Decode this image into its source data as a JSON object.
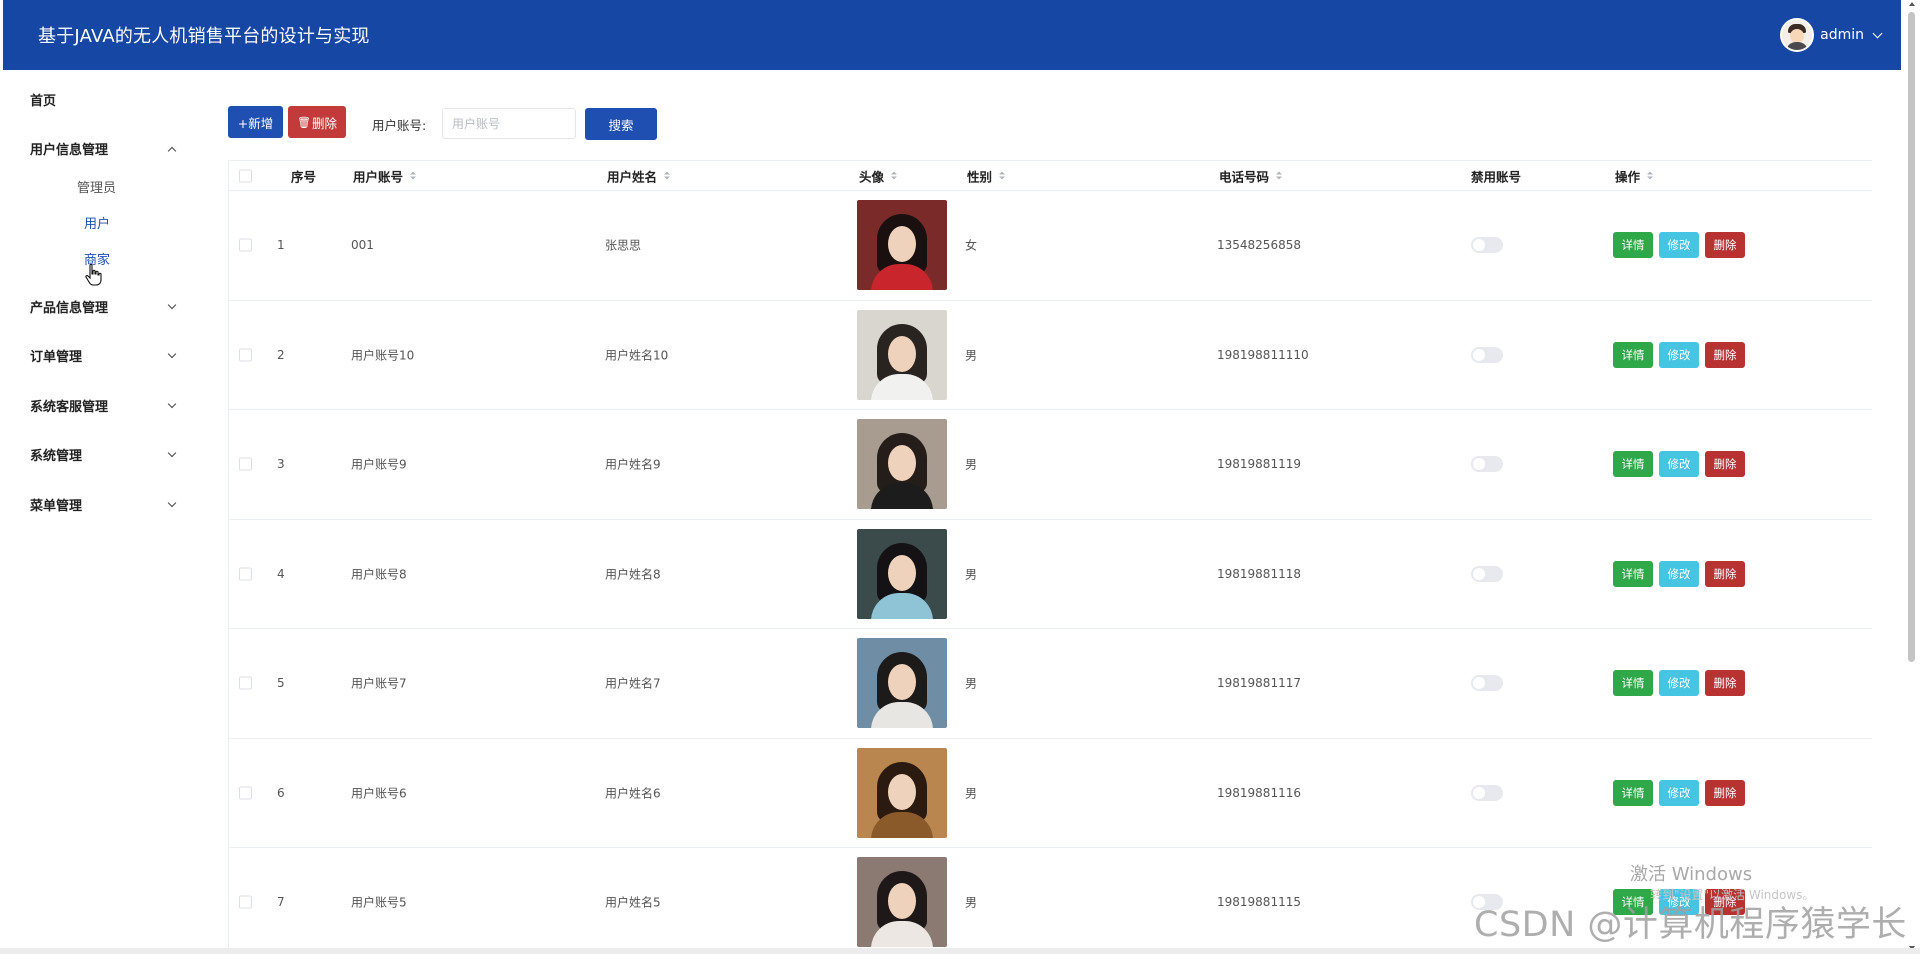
{
  "header": {
    "title": "基于JAVA的无人机销售平台的设计与实现",
    "username": "admin"
  },
  "sidebar": {
    "items": [
      {
        "label": "首页"
      },
      {
        "label": "用户信息管理",
        "expanded": true,
        "children": [
          {
            "label": "管理员"
          },
          {
            "label": "用户"
          },
          {
            "label": "商家"
          }
        ]
      },
      {
        "label": "产品信息管理"
      },
      {
        "label": "订单管理"
      },
      {
        "label": "系统客服管理"
      },
      {
        "label": "系统管理"
      },
      {
        "label": "菜单管理"
      }
    ]
  },
  "toolbar": {
    "add_label": "+新增",
    "delete_label": "删除",
    "search_label": "用户账号:",
    "search_placeholder": "用户账号",
    "search_button": "搜索"
  },
  "table": {
    "headers": {
      "index": "序号",
      "account": "用户账号",
      "name": "用户姓名",
      "avatar": "头像",
      "gender": "性别",
      "phone": "电话号码",
      "disabled": "禁用账号",
      "actions": "操作"
    },
    "action_labels": {
      "detail": "详情",
      "edit": "修改",
      "delete": "删除"
    },
    "rows": [
      {
        "index": "1",
        "account": "001",
        "name": "张思思",
        "gender": "女",
        "phone": "13548256858",
        "disabled": false
      },
      {
        "index": "2",
        "account": "用户账号10",
        "name": "用户姓名10",
        "gender": "男",
        "phone": "198198811110",
        "disabled": false
      },
      {
        "index": "3",
        "account": "用户账号9",
        "name": "用户姓名9",
        "gender": "男",
        "phone": "19819881119",
        "disabled": false
      },
      {
        "index": "4",
        "account": "用户账号8",
        "name": "用户姓名8",
        "gender": "男",
        "phone": "19819881118",
        "disabled": false
      },
      {
        "index": "5",
        "account": "用户账号7",
        "name": "用户姓名7",
        "gender": "男",
        "phone": "19819881117",
        "disabled": false
      },
      {
        "index": "6",
        "account": "用户账号6",
        "name": "用户姓名6",
        "gender": "男",
        "phone": "19819881116",
        "disabled": false
      },
      {
        "index": "7",
        "account": "用户账号5",
        "name": "用户姓名5",
        "gender": "男",
        "phone": "19819881115",
        "disabled": false
      }
    ]
  },
  "watermarks": {
    "windows_activate": "激活 Windows",
    "windows_sub": "转到\"设置\"以激活 Windows。",
    "csdn": "CSDN @计算机程序猿学长"
  },
  "colors": {
    "header_bg": "#1747a5",
    "primary": "#1e4fb1",
    "danger": "#c23a3a",
    "success": "#2fa84a",
    "info": "#46c5e3",
    "active_menu": "#1e4fb1"
  }
}
